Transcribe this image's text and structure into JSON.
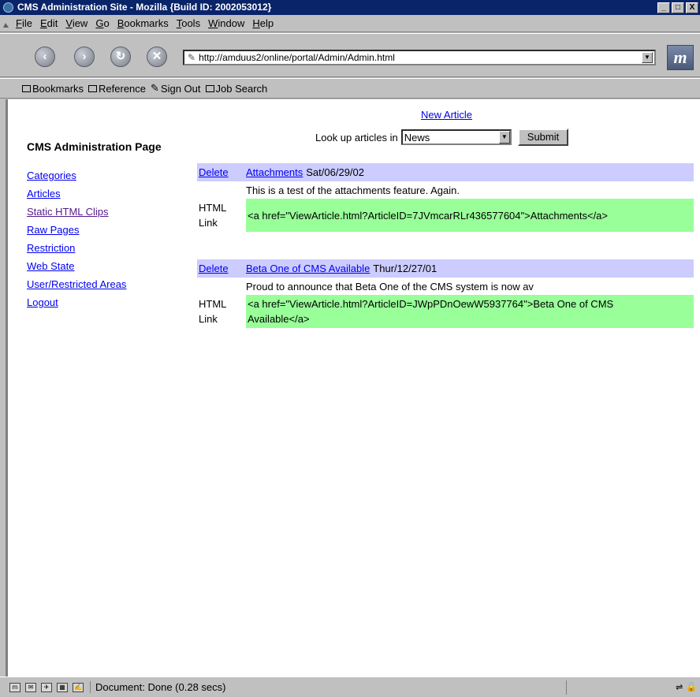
{
  "window": {
    "title": "CMS Administration Site - Mozilla {Build ID: 2002053012}",
    "min_label": "_",
    "max_label": "□",
    "close_label": "X"
  },
  "menubar": {
    "items": [
      "File",
      "Edit",
      "View",
      "Go",
      "Bookmarks",
      "Tools",
      "Window",
      "Help"
    ]
  },
  "navbar": {
    "back_label": "‹",
    "forward_label": "›",
    "reload_label": "↻",
    "stop_label": "✕",
    "url": "http://amduus2/online/portal/Admin/Admin.html",
    "throbber_label": "m"
  },
  "personalbar": {
    "items": [
      "Bookmarks",
      "Reference",
      "Sign Out",
      "Job Search"
    ]
  },
  "page": {
    "heading": "CMS Administration Page",
    "nav_links": [
      "Categories",
      "Articles",
      "Static HTML Clips",
      "Raw Pages",
      "Restriction",
      "Web State",
      "User/Restricted Areas",
      "Logout"
    ],
    "new_article_label": "New Article",
    "lookup_label": "Look up articles in",
    "lookup_selected": "News",
    "submit_label": "Submit",
    "delete_label": "Delete",
    "html_link_label_1": "HTML",
    "html_link_label_2": "Link",
    "articles": [
      {
        "title": "Attachments",
        "date": "Sat/06/29/02",
        "description": "This is a test of the attachments feature. Again.",
        "html_link_line1": "<a href=\"ViewArticle.html?ArticleID=7JVmcarRLr436577604\">Attachments</a>",
        "html_link_line2": ""
      },
      {
        "title": "Beta One of CMS Available",
        "date": "Thur/12/27/01",
        "description": "Proud to announce that Beta One of the CMS system is now av",
        "html_link_line1": "<a href=\"ViewArticle.html?ArticleID=JWpPDnOewW5937764\">Beta One of CMS",
        "html_link_line2": "Available</a>"
      }
    ]
  },
  "statusbar": {
    "text": "Document: Done (0.28 secs)"
  },
  "colors": {
    "titlebar": "#0a246a",
    "article_header": "#ccccff",
    "html_link_bg": "#99ff99",
    "link": "#0000ee",
    "visited_link": "#551a8b"
  }
}
